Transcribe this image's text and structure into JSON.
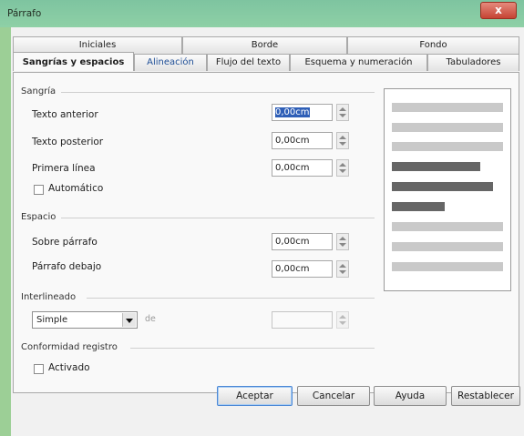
{
  "window": {
    "title": "Párrafo",
    "close_label": "x"
  },
  "tabs_row1": [
    "Iniciales",
    "Borde",
    "Fondo"
  ],
  "tabs_row2": [
    "Sangrías y espacios",
    "Alineación",
    "Flujo del texto",
    "Esquema y numeración",
    "Tabuladores"
  ],
  "indent": {
    "section_label": "Sangría",
    "before_label": "Texto anterior",
    "before_value": "0,00cm",
    "after_label": "Texto posterior",
    "after_value": "0,00cm",
    "first_label": "Primera línea",
    "first_value": "0,00cm",
    "auto_label": "Automático"
  },
  "spacing": {
    "section_label": "Espacio",
    "above_label": "Sobre párrafo",
    "above_value": "0,00cm",
    "below_label": "Párrafo debajo",
    "below_value": "0,00cm"
  },
  "line_spacing": {
    "section_label": "Interlineado",
    "selected": "Simple",
    "de_label": "de",
    "value": ""
  },
  "register": {
    "section_label": "Conformidad registro",
    "activated_label": "Activado"
  },
  "buttons": {
    "ok": "Aceptar",
    "cancel": "Cancelar",
    "help": "Ayuda",
    "reset": "Restablecer"
  },
  "colors": {
    "title_bar": "#8ed0a6",
    "close_button": "#c54434",
    "dialog_bg": "#f1f1f1",
    "preview_line": "#c9c9c9",
    "preview_line_dark": "#666666"
  }
}
